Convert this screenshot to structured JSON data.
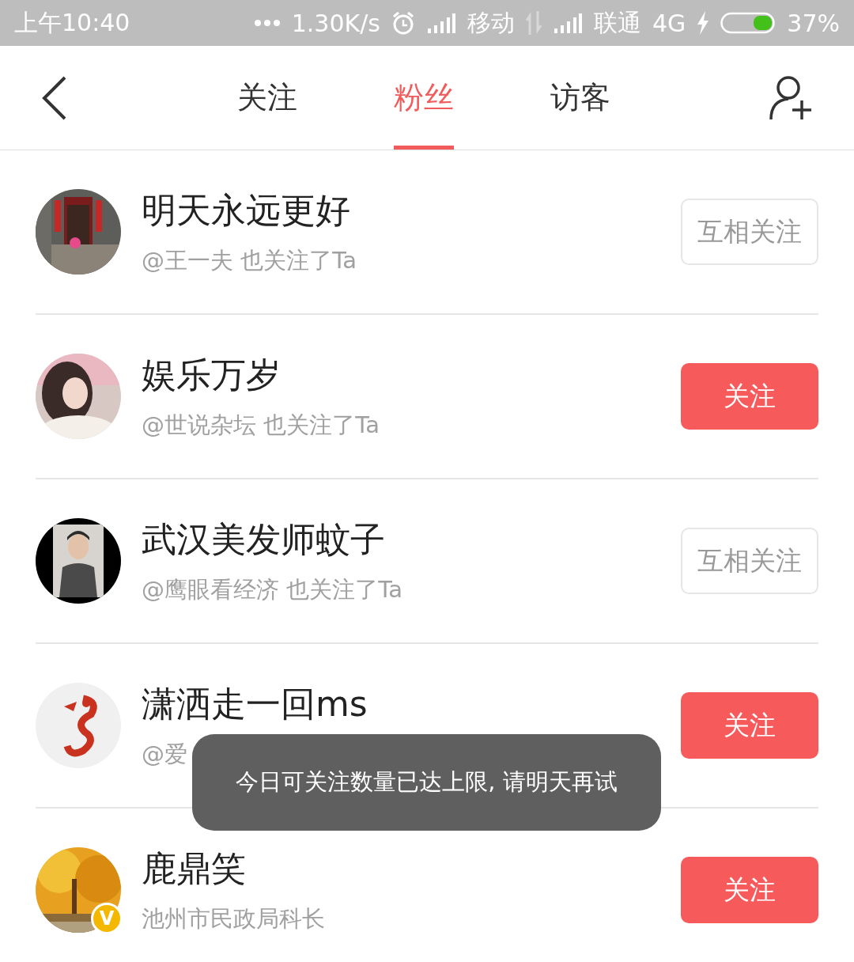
{
  "status_bar": {
    "time": "上午10:40",
    "speed": "1.30K/s",
    "carrier_1": "移动",
    "carrier_2": "联通",
    "network": "4G",
    "battery": "37%"
  },
  "tabs": [
    {
      "label": "关注",
      "selected": false
    },
    {
      "label": "粉丝",
      "selected": true
    },
    {
      "label": "访客",
      "selected": false
    }
  ],
  "fans": [
    {
      "name": "明天永远更好",
      "subtitle": "@王一夫 也关注了Ta",
      "button": "互相关注",
      "followed": true
    },
    {
      "name": "娱乐万岁",
      "subtitle": "@世说杂坛 也关注了Ta",
      "button": "关注",
      "followed": false
    },
    {
      "name": "武汉美发师蚊子",
      "subtitle": "@鹰眼看经济 也关注了Ta",
      "button": "互相关注",
      "followed": true
    },
    {
      "name": "潇洒走一回ms",
      "subtitle": "@爱",
      "button": "关注",
      "followed": false
    },
    {
      "name": "鹿鼎笑",
      "subtitle": "池州市民政局科长",
      "button": "关注",
      "followed": false,
      "badge": "V"
    }
  ],
  "toast": "今日可关注数量已达上限, 请明天再试"
}
